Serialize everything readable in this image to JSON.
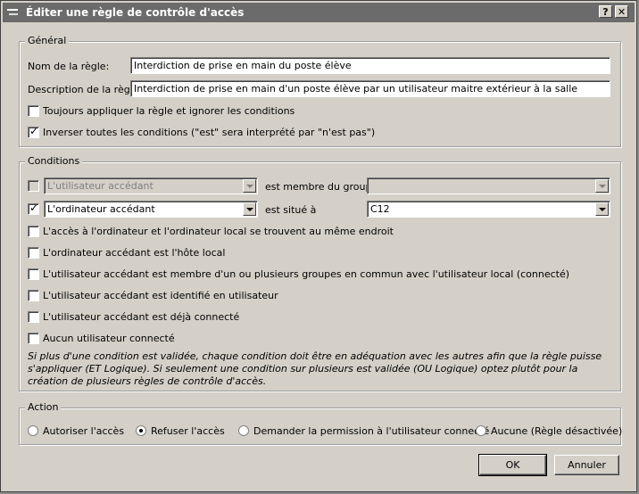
{
  "window": {
    "title": "Éditer une règle de contrôle d'accès",
    "help_label": "?",
    "close_label": "✕"
  },
  "general": {
    "legend": "Général",
    "name_label": "Nom de la règle:",
    "name_value": "Interdiction de prise en main du poste élève",
    "desc_label": "Description de la règle:",
    "desc_value": "Interdiction de prise en main d'un poste élève par un utilisateur maitre extérieur à la salle",
    "always_apply": {
      "label": "Toujours appliquer la règle et ignorer les conditions",
      "checked": false
    },
    "invert": {
      "label": "Inverser toutes les conditions (\"est\" sera interprété par \"n'est pas\")",
      "checked": true
    }
  },
  "conditions": {
    "legend": "Conditions",
    "row1": {
      "checked": false,
      "subject": "L'utilisateur accédant",
      "relation": "est membre du groupe",
      "value": ""
    },
    "row2": {
      "checked": true,
      "subject": "L'ordinateur accédant",
      "relation": "est situé à",
      "value": "C12"
    },
    "items": [
      {
        "label": "L'accès à l'ordinateur et l'ordinateur local se trouvent au même endroit",
        "checked": false
      },
      {
        "label": "L'ordinateur accédant est l'hôte local",
        "checked": false
      },
      {
        "label": "L'utilisateur accédant est membre d'un ou plusieurs groupes en commun avec l'utilisateur local (connecté)",
        "checked": false
      },
      {
        "label": "L'utilisateur accédant est identifié en utilisateur",
        "checked": false
      },
      {
        "label": "L'utilisateur accédant est déjà connecté",
        "checked": false
      },
      {
        "label": "Aucun utilisateur connecté",
        "checked": false
      }
    ],
    "note": "Si plus d'une condition est validée, chaque condition doit être en adéquation avec les autres afin que la règle puisse s'appliquer (ET Logique). Si seulement une condition sur plusieurs est validée (OU Logique) optez plutôt pour la création de plusieurs règles de contrôle d'accès."
  },
  "action": {
    "legend": "Action",
    "options": [
      {
        "label": "Autoriser l'accès",
        "selected": false
      },
      {
        "label": "Refuser l'accès",
        "selected": true
      },
      {
        "label": "Demander la permission à l'utilisateur connecté",
        "selected": false
      },
      {
        "label": "Aucune (Règle désactivée)",
        "selected": false
      }
    ]
  },
  "buttons": {
    "ok": "OK",
    "cancel": "Annuler"
  }
}
